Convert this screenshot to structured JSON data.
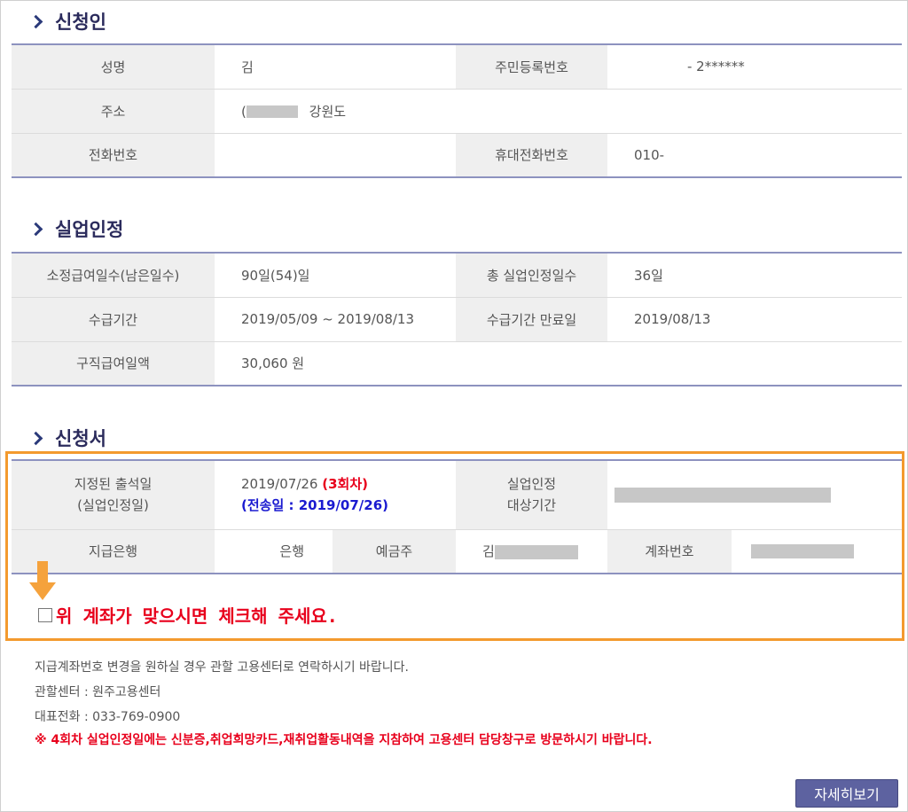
{
  "applicant": {
    "title": "신청인",
    "name_label": "성명",
    "name_value": "김",
    "rrn_label": "주민등록번호",
    "rrn_value": "- 2******",
    "address_label": "주소",
    "address_prefix": "(",
    "address_value": "강원도",
    "phone_label": "전화번호",
    "phone_value": "",
    "mobile_label": "휴대전화번호",
    "mobile_value": "010-"
  },
  "recognition": {
    "title": "실업인정",
    "days_label": "소정급여일수(남은일수)",
    "days_value": "90일(54)일",
    "total_label": "총 실업인정일수",
    "total_value": "36일",
    "period_label": "수급기간",
    "period_value": "2019/05/09 ~ 2019/08/13",
    "end_label": "수급기간 만료일",
    "end_value": "2019/08/13",
    "amount_label": "구직급여일액",
    "amount_value": "30,060 원"
  },
  "application": {
    "title": "신청서",
    "attend_label_1": "지정된 출석일",
    "attend_label_2": "(실업인정일)",
    "attend_date": "2019/07/26",
    "attend_round": "(3회차)",
    "sent_date": "(전송일 : 2019/07/26)",
    "target_label_1": "실업인정",
    "target_label_2": "대상기간",
    "bank_label": "지급은행",
    "bank_value": "은행",
    "holder_label": "예금주",
    "holder_value": "김",
    "account_label": "계좌번호",
    "confirm_text": "위 계좌가 맞으시면 체크해 주세요.",
    "confirm_checked": false
  },
  "notes": {
    "line1": "지급계좌번호 변경을 원하실 경우 관할 고용센터로 연락하시기 바랍니다.",
    "line2": "관할센터 : 원주고용센터",
    "line3": "대표전화 : 033-769-0900",
    "warning": "※ 4회차 실업인정일에는 신분증,취업희망카드,재취업활동내역을 지참하여 고용센터 담당창구로 방문하시기 바랍니다."
  },
  "buttons": {
    "detail": "자세히보기"
  },
  "colors": {
    "accent_border": "#f39a2e",
    "table_rule": "#8d92bf",
    "warning_red": "#e8001c",
    "sent_blue": "#1a1ad0",
    "button_bg": "#5d62a0"
  },
  "icons": {
    "section": "chevron-right-icon",
    "pointer": "down-arrow-icon"
  }
}
